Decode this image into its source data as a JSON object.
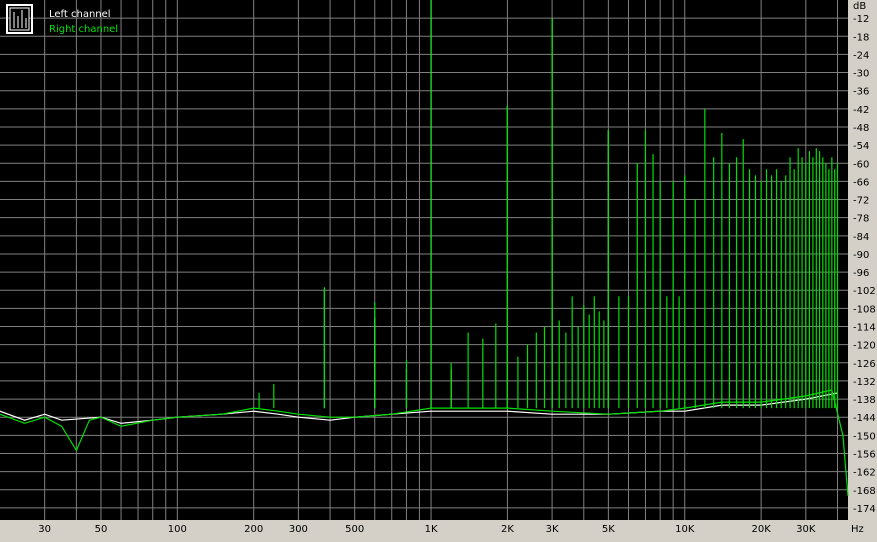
{
  "chart_data": {
    "type": "line",
    "title": "",
    "xlabel": "",
    "ylabel": "",
    "x_unit": "Hz",
    "y_unit": "dB",
    "x_scale": "log",
    "xlim": [
      20,
      44000
    ],
    "ylim": [
      -178,
      -6
    ],
    "x_ticks": [
      {
        "value": 30,
        "label": "30"
      },
      {
        "value": 50,
        "label": "50"
      },
      {
        "value": 100,
        "label": "100"
      },
      {
        "value": 200,
        "label": "200"
      },
      {
        "value": 300,
        "label": "300"
      },
      {
        "value": 500,
        "label": "500"
      },
      {
        "value": 1000,
        "label": "1K"
      },
      {
        "value": 2000,
        "label": "2K"
      },
      {
        "value": 3000,
        "label": "3K"
      },
      {
        "value": 5000,
        "label": "5K"
      },
      {
        "value": 10000,
        "label": "10K"
      },
      {
        "value": 20000,
        "label": "20K"
      },
      {
        "value": 30000,
        "label": "30K"
      }
    ],
    "x_minor_gridlines": [
      40,
      60,
      70,
      80,
      90,
      400,
      600,
      700,
      800,
      900,
      4000,
      6000,
      7000,
      8000,
      9000,
      40000
    ],
    "y_ticks": [
      -12,
      -18,
      -24,
      -30,
      -36,
      -42,
      -48,
      -54,
      -60,
      -66,
      -72,
      -78,
      -84,
      -90,
      -96,
      -102,
      -108,
      -114,
      -120,
      -126,
      -132,
      -138,
      -144,
      -150,
      -156,
      -162,
      -168,
      -174
    ],
    "grid": true,
    "legend_position": "top-left",
    "series": [
      {
        "name": "Left channel",
        "color": "#ffffff",
        "noise_floor": [
          [
            20,
            -142
          ],
          [
            25,
            -145
          ],
          [
            30,
            -143
          ],
          [
            35,
            -145
          ],
          [
            50,
            -144
          ],
          [
            60,
            -146
          ],
          [
            80,
            -145
          ],
          [
            100,
            -144
          ],
          [
            150,
            -143
          ],
          [
            200,
            -142
          ],
          [
            250,
            -143
          ],
          [
            300,
            -144
          ],
          [
            400,
            -145
          ],
          [
            500,
            -144
          ],
          [
            700,
            -143
          ],
          [
            1000,
            -142
          ],
          [
            1500,
            -142
          ],
          [
            2000,
            -142
          ],
          [
            3000,
            -143
          ],
          [
            5000,
            -143
          ],
          [
            8000,
            -142
          ],
          [
            10000,
            -142
          ],
          [
            14000,
            -140
          ],
          [
            20000,
            -140
          ],
          [
            30000,
            -138
          ],
          [
            40000,
            -136
          ]
        ],
        "peaks": [
          [
            380,
            -102
          ],
          [
            600,
            -111
          ],
          [
            800,
            -128
          ],
          [
            1000,
            -6
          ],
          [
            1200,
            -128
          ],
          [
            2000,
            -41
          ],
          [
            3000,
            -12
          ],
          [
            5000,
            -49
          ]
        ]
      },
      {
        "name": "Right channel",
        "color": "#00e000",
        "noise_floor": [
          [
            20,
            -143
          ],
          [
            25,
            -146
          ],
          [
            30,
            -144
          ],
          [
            35,
            -147
          ],
          [
            40,
            -155
          ],
          [
            45,
            -145
          ],
          [
            50,
            -144
          ],
          [
            60,
            -147
          ],
          [
            80,
            -145
          ],
          [
            100,
            -144
          ],
          [
            150,
            -143
          ],
          [
            200,
            -141
          ],
          [
            250,
            -142
          ],
          [
            300,
            -143
          ],
          [
            400,
            -144
          ],
          [
            500,
            -144
          ],
          [
            700,
            -143
          ],
          [
            1000,
            -141
          ],
          [
            1500,
            -141
          ],
          [
            2000,
            -141
          ],
          [
            3000,
            -142
          ],
          [
            5000,
            -143
          ],
          [
            8000,
            -142
          ],
          [
            10000,
            -141
          ],
          [
            14000,
            -139
          ],
          [
            20000,
            -139
          ],
          [
            30000,
            -137
          ],
          [
            38000,
            -135
          ],
          [
            42000,
            -150
          ],
          [
            44000,
            -170
          ]
        ],
        "peaks": [
          [
            210,
            -136
          ],
          [
            240,
            -133
          ],
          [
            380,
            -101
          ],
          [
            600,
            -106
          ],
          [
            800,
            -125
          ],
          [
            1000,
            -6
          ],
          [
            1200,
            -126
          ],
          [
            1400,
            -116
          ],
          [
            1600,
            -118
          ],
          [
            1800,
            -113
          ],
          [
            2000,
            -41
          ],
          [
            2200,
            -124
          ],
          [
            2400,
            -120
          ],
          [
            2600,
            -116
          ],
          [
            2800,
            -114
          ],
          [
            3000,
            -12
          ],
          [
            3200,
            -112
          ],
          [
            3400,
            -116
          ],
          [
            3600,
            -104
          ],
          [
            3800,
            -114
          ],
          [
            4000,
            -107
          ],
          [
            4200,
            -110
          ],
          [
            4400,
            -104
          ],
          [
            4600,
            -109
          ],
          [
            4800,
            -112
          ],
          [
            5000,
            -49
          ],
          [
            5500,
            -104
          ],
          [
            6000,
            -104
          ],
          [
            6500,
            -60
          ],
          [
            7000,
            -49
          ],
          [
            7500,
            -57
          ],
          [
            8000,
            -66
          ],
          [
            8500,
            -104
          ],
          [
            9000,
            -66
          ],
          [
            9500,
            -104
          ],
          [
            10000,
            -64
          ],
          [
            11000,
            -72
          ],
          [
            12000,
            -42
          ],
          [
            13000,
            -58
          ],
          [
            14000,
            -50
          ],
          [
            15000,
            -60
          ],
          [
            16000,
            -58
          ],
          [
            17000,
            -52
          ],
          [
            18000,
            -62
          ],
          [
            19000,
            -64
          ],
          [
            20000,
            -66
          ],
          [
            21000,
            -62
          ],
          [
            22000,
            -64
          ],
          [
            23000,
            -62
          ],
          [
            24000,
            -66
          ],
          [
            25000,
            -64
          ],
          [
            26000,
            -58
          ],
          [
            27000,
            -62
          ],
          [
            28000,
            -55
          ],
          [
            29000,
            -58
          ],
          [
            30000,
            -60
          ],
          [
            31000,
            -56
          ],
          [
            32000,
            -58
          ],
          [
            33000,
            -55
          ],
          [
            34000,
            -56
          ],
          [
            35000,
            -58
          ],
          [
            36000,
            -60
          ],
          [
            37000,
            -62
          ],
          [
            38000,
            -58
          ],
          [
            39000,
            -62
          ],
          [
            40000,
            -60
          ]
        ]
      }
    ]
  },
  "legend": {
    "entries": [
      {
        "label": "Left channel",
        "color": "#ffffff"
      },
      {
        "label": "Right channel",
        "color": "#00e000"
      }
    ]
  },
  "colors": {
    "plot_background": "#000000",
    "grid": "#808080",
    "frame_background": "#d4d0c8"
  },
  "icons": {
    "legend_icon": "spectrum-icon"
  }
}
